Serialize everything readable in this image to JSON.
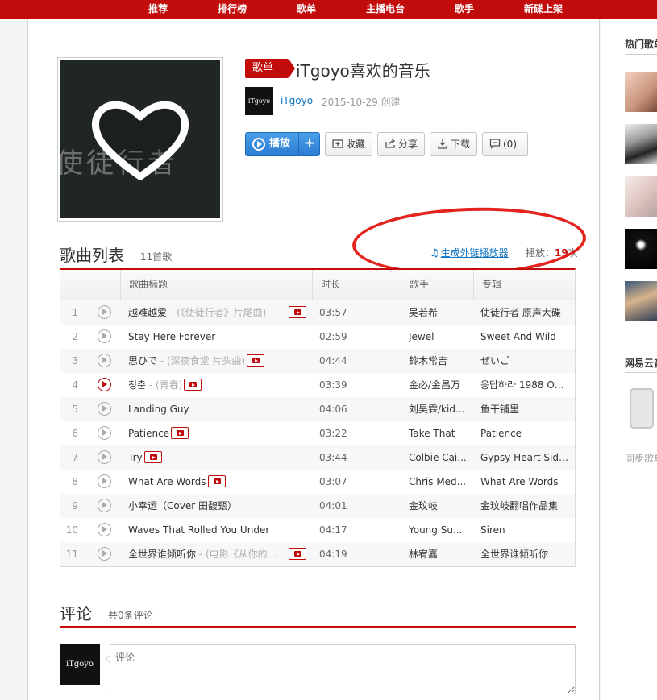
{
  "nav": {
    "items": [
      "推荐",
      "排行榜",
      "歌单",
      "主播电台",
      "歌手",
      "新碟上架"
    ]
  },
  "playlist": {
    "tag": "歌单",
    "title": "iTgoyo喜欢的音乐",
    "creator": "iTgoyo",
    "avatar_text": "iTgoyo",
    "create_date": "2015-10-29 创建",
    "cover_text": "使徒行者"
  },
  "buttons": {
    "play": "播放",
    "add": "+",
    "collect": "收藏",
    "share": "分享",
    "download": "下载",
    "comment": "(0)"
  },
  "songlist": {
    "title": "歌曲列表",
    "count": "11首歌",
    "outchain": "生成外链播放器",
    "play_label": "播放：",
    "play_count": "19",
    "play_unit": "次",
    "columns": [
      "歌曲标题",
      "时长",
      "歌手",
      "专辑"
    ],
    "songs": [
      {
        "idx": "1",
        "title": "越难越爱",
        "alias": " - (《使徒行者》片尾曲)",
        "mv": true,
        "duration": "03:57",
        "artist": "吴若希",
        "album": "使徒行者 原声大碟"
      },
      {
        "idx": "2",
        "title": "Stay Here Forever",
        "alias": "",
        "mv": false,
        "duration": "02:59",
        "artist": "Jewel",
        "album": "Sweet And Wild"
      },
      {
        "idx": "3",
        "title": "思ひで",
        "alias": " - (深夜食堂 片头曲)",
        "mv": true,
        "duration": "04:44",
        "artist": "鈴木常吉",
        "album": "ぜいご"
      },
      {
        "idx": "4",
        "title": "청춘",
        "alias": " - (青春)",
        "mv": true,
        "duration": "03:39",
        "artist": "金必/金昌万",
        "album": "응답하라 1988 OS..."
      },
      {
        "idx": "5",
        "title": "Landing Guy",
        "alias": "",
        "mv": false,
        "duration": "04:06",
        "artist": "刘昊霖/kid...",
        "album": "鱼干铺里"
      },
      {
        "idx": "6",
        "title": "Patience",
        "alias": "",
        "mv": true,
        "duration": "03:22",
        "artist": "Take That",
        "album": "Patience"
      },
      {
        "idx": "7",
        "title": "Try",
        "alias": "",
        "mv": true,
        "duration": "03:44",
        "artist": "Colbie Cai...",
        "album": "Gypsy Heart Side A"
      },
      {
        "idx": "8",
        "title": "What Are Words",
        "alias": "",
        "mv": true,
        "duration": "03:07",
        "artist": "Chris Med...",
        "album": "What Are Words"
      },
      {
        "idx": "9",
        "title": "小幸运（Cover 田馥甄）",
        "alias": "",
        "mv": false,
        "duration": "04:01",
        "artist": "金玟岐",
        "album": "金玟岐翻唱作品集"
      },
      {
        "idx": "10",
        "title": "Waves That Rolled You Under",
        "alias": "",
        "mv": false,
        "duration": "04:17",
        "artist": "Young Su...",
        "album": "Siren"
      },
      {
        "idx": "11",
        "title": "全世界谁倾听你",
        "alias": " - (电影《从你的...",
        "mv": true,
        "duration": "04:19",
        "artist": "林宥嘉",
        "album": "全世界谁倾听你"
      }
    ]
  },
  "comments": {
    "title": "评论",
    "count": "共0条评论",
    "avatar_text": "iTgoyo",
    "placeholder": "评论"
  },
  "sidebar": {
    "hot_title": "热门歌单",
    "app_title": "网易云音乐",
    "sync_text": "同步歌单"
  }
}
